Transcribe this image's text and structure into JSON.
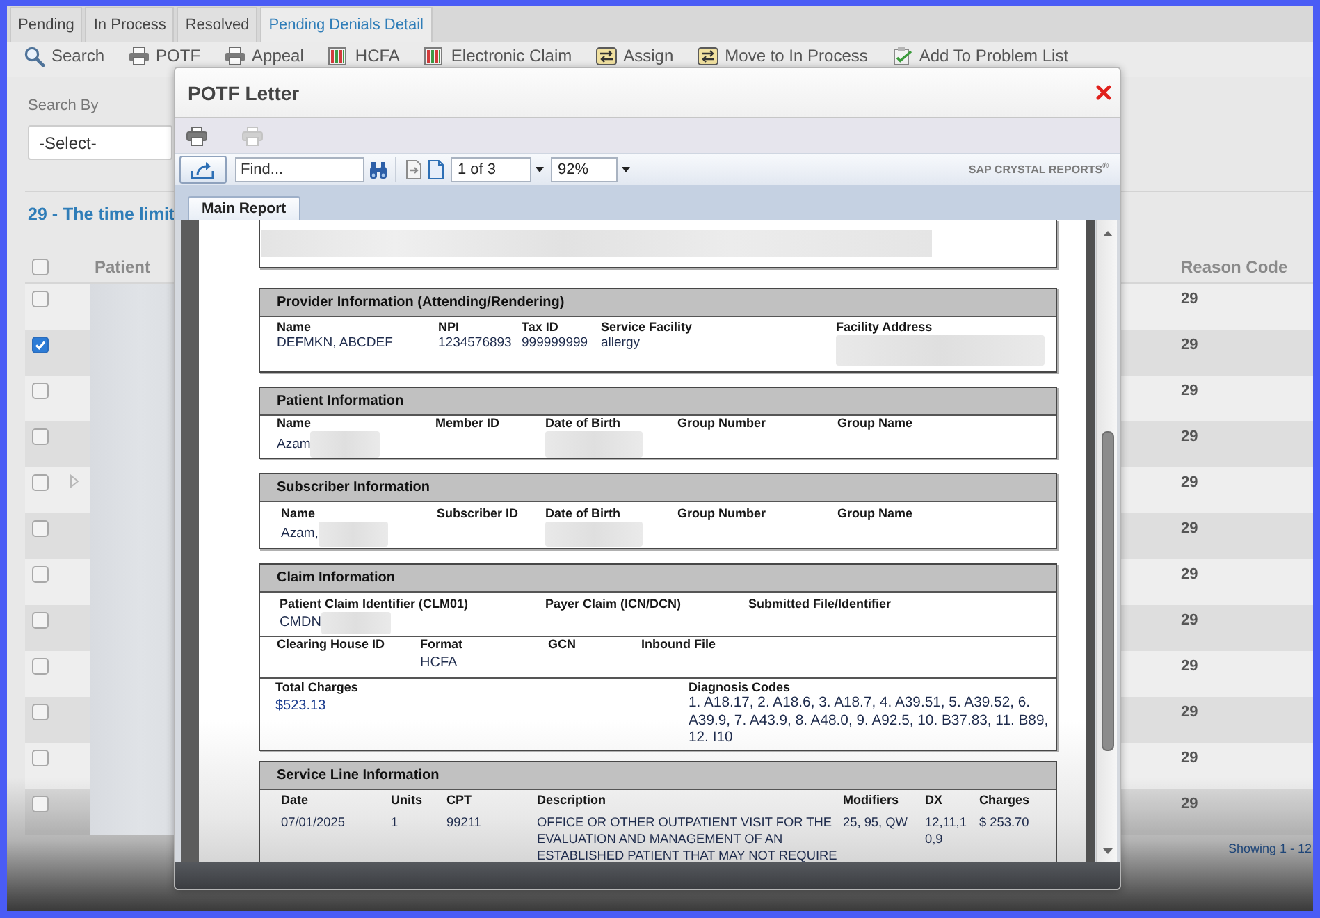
{
  "tabs": [
    {
      "label": "Pending",
      "selected": false
    },
    {
      "label": "In Process",
      "selected": false
    },
    {
      "label": "Resolved",
      "selected": false
    },
    {
      "label": "Pending Denials Detail",
      "selected": true
    }
  ],
  "toolbar": [
    {
      "kind": "search",
      "label": "Search"
    },
    {
      "kind": "printer",
      "label": "POTF"
    },
    {
      "kind": "printer",
      "label": "Appeal"
    },
    {
      "kind": "form",
      "label": "HCFA"
    },
    {
      "kind": "form",
      "label": "Electronic Claim"
    },
    {
      "kind": "assign",
      "label": "Assign"
    },
    {
      "kind": "assign",
      "label": "Move to In Process"
    },
    {
      "kind": "checklist",
      "label": "Add To Problem List"
    }
  ],
  "search_panel": {
    "label": "Search By",
    "value": "-Select-"
  },
  "result_heading": "29 - The time limit",
  "table": {
    "select_all_checked": false,
    "columns": [
      "Patient",
      "Reason Code"
    ],
    "rows": [
      {
        "checked": false,
        "has_children": false,
        "patient_redacted": true,
        "reason_code": "29"
      },
      {
        "checked": true,
        "has_children": false,
        "patient_redacted": true,
        "reason_code": "29"
      },
      {
        "checked": false,
        "has_children": false,
        "patient_redacted": true,
        "reason_code": "29"
      },
      {
        "checked": false,
        "has_children": false,
        "patient_redacted": true,
        "reason_code": "29"
      },
      {
        "checked": false,
        "has_children": true,
        "patient_redacted": true,
        "reason_code": "29"
      },
      {
        "checked": false,
        "has_children": false,
        "patient_redacted": true,
        "reason_code": "29"
      },
      {
        "checked": false,
        "has_children": false,
        "patient_redacted": true,
        "reason_code": "29"
      },
      {
        "checked": false,
        "has_children": false,
        "patient_redacted": true,
        "reason_code": "29"
      },
      {
        "checked": false,
        "has_children": false,
        "patient_redacted": true,
        "reason_code": "29"
      },
      {
        "checked": false,
        "has_children": false,
        "patient_redacted": true,
        "reason_code": "29"
      },
      {
        "checked": false,
        "has_children": false,
        "patient_redacted": true,
        "reason_code": "29"
      },
      {
        "checked": false,
        "has_children": false,
        "patient_redacted": true,
        "reason_code": "29"
      }
    ],
    "footer": "Showing 1 - 12"
  },
  "dialog": {
    "title": "POTF Letter",
    "print_buttons": [
      {
        "disabled": false
      },
      {
        "disabled": true
      }
    ],
    "viewer": {
      "find_placeholder": "Find...",
      "page": "1 of 3",
      "zoom": "92%",
      "brand": "SAP CRYSTAL REPORTS$^{®}$",
      "tabs": [
        {
          "label": "Main Report",
          "selected": true
        }
      ]
    },
    "report": {
      "sections": [
        {
          "kind": "redacted_bar"
        },
        {
          "kind": "fields",
          "title": "Provider Information (Attending/Rendering)",
          "rows": [
            {
              "fields": [
                {
                  "label": "Name",
                  "value": "DEFMKN, ABCDEF",
                  "redacted": false
                },
                {
                  "label": "NPI",
                  "value": "1234576893",
                  "redacted": false
                },
                {
                  "label": "Tax ID",
                  "value": "999999999",
                  "redacted": false
                },
                {
                  "label": "Service Facility",
                  "value": "allergy",
                  "redacted": false
                },
                {
                  "label": "Facility Address",
                  "redacted": true
                }
              ]
            }
          ]
        },
        {
          "kind": "fields",
          "title": "Patient Information",
          "rows": [
            {
              "fields": [
                {
                  "label": "Name",
                  "value": "Azam",
                  "redacted": true
                },
                {
                  "label": "Member ID",
                  "redacted": false
                },
                {
                  "label": "Date of Birth",
                  "redacted": true
                },
                {
                  "label": "Group Number",
                  "redacted": false
                },
                {
                  "label": "Group Name",
                  "redacted": false
                }
              ]
            }
          ]
        },
        {
          "kind": "fields",
          "title": "Subscriber Information",
          "rows": [
            {
              "fields": [
                {
                  "label": "Name",
                  "value": "Azam,",
                  "redacted": true
                },
                {
                  "label": "Subscriber ID",
                  "redacted": false
                },
                {
                  "label": "Date of Birth",
                  "redacted": true
                },
                {
                  "label": "Group Number",
                  "redacted": false
                },
                {
                  "label": "Group Name",
                  "redacted": false
                }
              ]
            }
          ]
        },
        {
          "kind": "fields",
          "title": "Claim Information",
          "rows": [
            {
              "fields": [
                {
                  "label": "Patient Claim Identifier (CLM01)",
                  "value": "CMDN",
                  "redacted": true
                },
                {
                  "label": "Payer Claim (ICN/DCN)",
                  "redacted": false
                },
                {
                  "label": "Submitted File/Identifier",
                  "redacted": false
                }
              ]
            },
            {
              "fields": [
                {
                  "label": "Clearing House ID",
                  "redacted": false
                },
                {
                  "label": "Format",
                  "value": "HCFA",
                  "redacted": false
                },
                {
                  "label": "GCN",
                  "redacted": false
                },
                {
                  "label": "Inbound File",
                  "redacted": false
                }
              ]
            },
            {
              "fields": [
                {
                  "label": "Total Charges",
                  "value": "$523.13",
                  "redacted": false
                },
                {
                  "label": "Diagnosis Codes",
                  "value": "1. A18.17, 2. A18.6, 3. A18.7, 4. A39.51, 5. A39.52, 6. A39.9, 7. A43.9, 8. A48.0, 9. A92.5, 10. B37.83, 11. B89, 12. I10",
                  "redacted": false
                }
              ]
            }
          ]
        },
        {
          "kind": "table",
          "title": "Service Line Information",
          "columns": [
            "Date",
            "Units",
            "CPT",
            "Description",
            "Modifiers",
            "DX",
            "Charges"
          ],
          "rows": [
            {
              "cells": [
                "07/01/2025",
                "1",
                "99211",
                "OFFICE OR OTHER OUTPATIENT VISIT FOR THE EVALUATION AND MANAGEMENT OF AN ESTABLISHED PATIENT THAT MAY NOT REQUIRE",
                "25, 95, QW",
                "12,11,10,9",
                "$ 253.70"
              ]
            }
          ]
        }
      ]
    }
  }
}
